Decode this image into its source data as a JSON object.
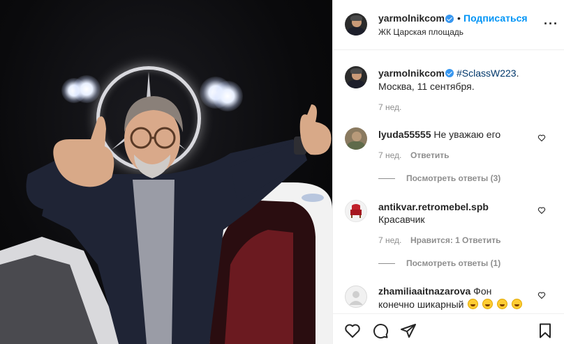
{
  "post": {
    "author": "yarmolnikcom",
    "follow_label": "Подписаться",
    "separator": "•",
    "location": "ЖК Царская площадь",
    "more_label": "···"
  },
  "caption": {
    "author": "yarmolnikcom",
    "hashtag": "#SclassW223",
    "after_hashtag": ".",
    "line2": "Москва, 11 сентября.",
    "time": "7 нед."
  },
  "comments": [
    {
      "user": "lyuda55555",
      "text": "Не уважаю его",
      "time": "7 нед.",
      "reply_label": "Ответить",
      "view_replies": "Посмотреть ответы (3)"
    },
    {
      "user": "antikvar.retromebel.spb",
      "text": "Красавчик",
      "time": "7 нед.",
      "likes_label": "Нравится: 1",
      "reply_label": "Ответить",
      "view_replies": "Посмотреть ответы (1)"
    },
    {
      "user": "zhamiliaaitnazarova",
      "text_line1": "Фон",
      "text_line2": "конечно шикарный"
    }
  ],
  "icons": {
    "like": "heart-icon",
    "comment": "comment-icon",
    "share": "share-icon",
    "save": "bookmark-icon"
  },
  "colors": {
    "accent": "#0095f6",
    "verified": "#3897f0",
    "hashtag": "#00376b",
    "muted": "#8e8e8e",
    "text": "#262626"
  }
}
